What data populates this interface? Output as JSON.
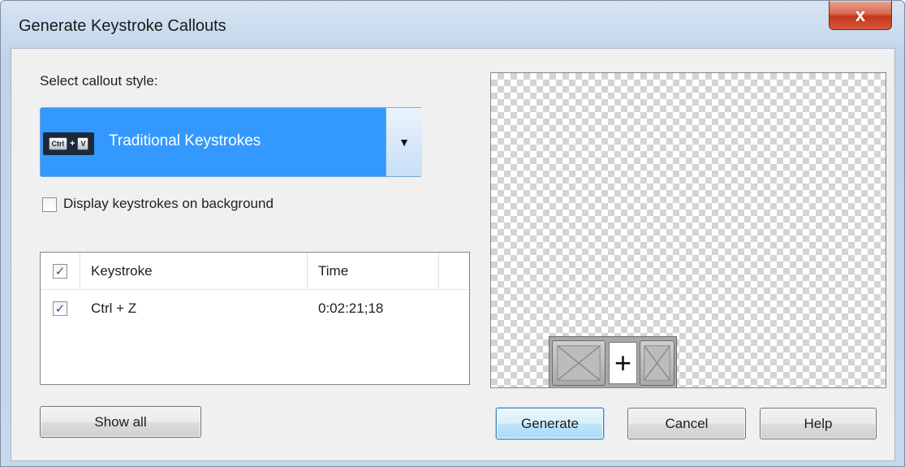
{
  "window": {
    "title": "Generate Keystroke Callouts",
    "close_glyph": "x"
  },
  "style_section": {
    "label": "Select callout style:",
    "selected_style": "Traditional Keystrokes",
    "thumbnail_keys": [
      "Ctrl",
      "+",
      "V"
    ],
    "dropdown_arrow": "▼"
  },
  "background_option": {
    "label": "Display keystrokes on background",
    "checked": false
  },
  "keystroke_list": {
    "header_checkbox_mark": "✓",
    "columns": [
      "Keystroke",
      "Time"
    ],
    "rows": [
      {
        "checked": true,
        "check_mark": "✓",
        "keystroke": "Ctrl + Z",
        "time": "0:02:21;18"
      }
    ]
  },
  "preview": {
    "plus_glyph": "+"
  },
  "buttons": {
    "show_all": "Show all",
    "generate": "Generate",
    "cancel": "Cancel",
    "help": "Help"
  },
  "colors": {
    "selection": "#3399ff",
    "close_button": "#c3381c",
    "default_button_border": "#3c7fb1"
  },
  "icons": [
    "close-icon",
    "keystroke-style-thumbnail-icon",
    "dropdown-arrow-icon",
    "checkbox-icon",
    "key-placeholder-icon"
  ]
}
